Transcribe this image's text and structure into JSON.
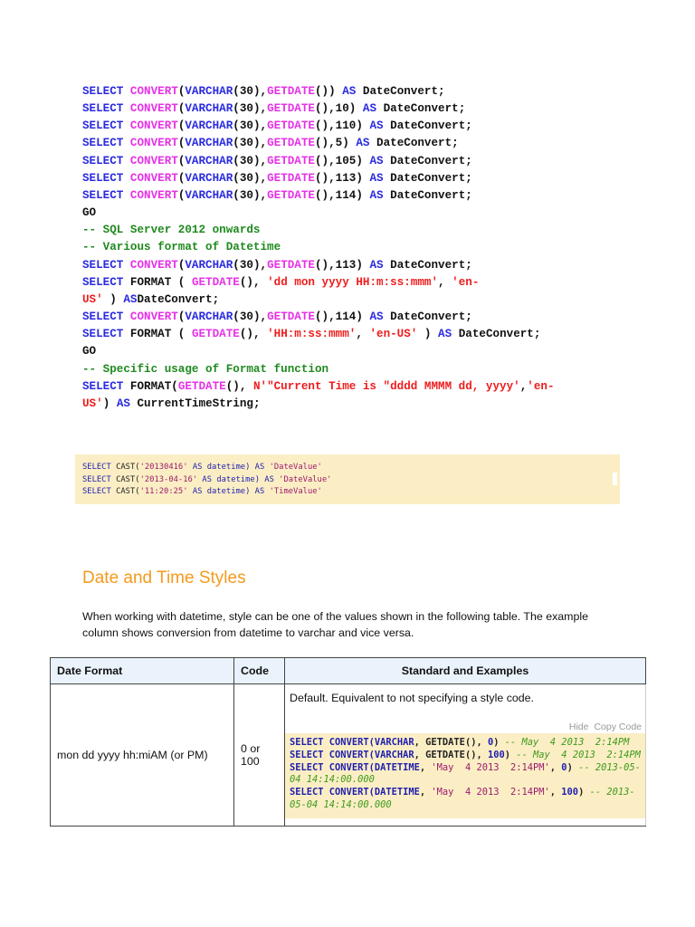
{
  "code_block_1": [
    [
      [
        "SELECT ",
        "k"
      ],
      [
        "CONVERT",
        "f"
      ],
      [
        "(",
        "d"
      ],
      [
        "VARCHAR",
        "k"
      ],
      [
        "(30),",
        "d"
      ],
      [
        "GETDATE",
        "f"
      ],
      [
        "()) ",
        "d"
      ],
      [
        "AS ",
        "k"
      ],
      [
        "DateConvert;",
        "d"
      ]
    ],
    [
      [
        "SELECT ",
        "k"
      ],
      [
        "CONVERT",
        "f"
      ],
      [
        "(",
        "d"
      ],
      [
        "VARCHAR",
        "k"
      ],
      [
        "(30),",
        "d"
      ],
      [
        "GETDATE",
        "f"
      ],
      [
        "(),10) ",
        "d"
      ],
      [
        "AS ",
        "k"
      ],
      [
        "DateConvert;",
        "d"
      ]
    ],
    [
      [
        "SELECT ",
        "k"
      ],
      [
        "CONVERT",
        "f"
      ],
      [
        "(",
        "d"
      ],
      [
        "VARCHAR",
        "k"
      ],
      [
        "(30),",
        "d"
      ],
      [
        "GETDATE",
        "f"
      ],
      [
        "(),110) ",
        "d"
      ],
      [
        "AS ",
        "k"
      ],
      [
        "DateConvert;",
        "d"
      ]
    ],
    [
      [
        "SELECT ",
        "k"
      ],
      [
        "CONVERT",
        "f"
      ],
      [
        "(",
        "d"
      ],
      [
        "VARCHAR",
        "k"
      ],
      [
        "(30),",
        "d"
      ],
      [
        "GETDATE",
        "f"
      ],
      [
        "(),5) ",
        "d"
      ],
      [
        "AS ",
        "k"
      ],
      [
        "DateConvert;",
        "d"
      ]
    ],
    [
      [
        "SELECT ",
        "k"
      ],
      [
        "CONVERT",
        "f"
      ],
      [
        "(",
        "d"
      ],
      [
        "VARCHAR",
        "k"
      ],
      [
        "(30),",
        "d"
      ],
      [
        "GETDATE",
        "f"
      ],
      [
        "(),105) ",
        "d"
      ],
      [
        "AS ",
        "k"
      ],
      [
        "DateConvert;",
        "d"
      ]
    ],
    [
      [
        "SELECT ",
        "k"
      ],
      [
        "CONVERT",
        "f"
      ],
      [
        "(",
        "d"
      ],
      [
        "VARCHAR",
        "k"
      ],
      [
        "(30),",
        "d"
      ],
      [
        "GETDATE",
        "f"
      ],
      [
        "(),113) ",
        "d"
      ],
      [
        "AS ",
        "k"
      ],
      [
        "DateConvert;",
        "d"
      ]
    ],
    [
      [
        "SELECT ",
        "k"
      ],
      [
        "CONVERT",
        "f"
      ],
      [
        "(",
        "d"
      ],
      [
        "VARCHAR",
        "k"
      ],
      [
        "(30),",
        "d"
      ],
      [
        "GETDATE",
        "f"
      ],
      [
        "(),114) ",
        "d"
      ],
      [
        "AS ",
        "k"
      ],
      [
        "DateConvert;",
        "d"
      ]
    ],
    [
      [
        "GO",
        "d"
      ]
    ],
    [
      [
        "-- SQL Server 2012 onwards",
        "c"
      ]
    ],
    [
      [
        "-- Various format of Datetime",
        "c"
      ]
    ],
    [
      [
        "SELECT ",
        "k"
      ],
      [
        "CONVERT",
        "f"
      ],
      [
        "(",
        "d"
      ],
      [
        "VARCHAR",
        "k"
      ],
      [
        "(30),",
        "d"
      ],
      [
        "GETDATE",
        "f"
      ],
      [
        "(),113) ",
        "d"
      ],
      [
        "AS ",
        "k"
      ],
      [
        "DateConvert;",
        "d"
      ]
    ],
    [
      [
        "SELECT ",
        "k"
      ],
      [
        "FORMAT ( ",
        "d"
      ],
      [
        "GETDATE",
        "f"
      ],
      [
        "(), ",
        "d"
      ],
      [
        "'dd mon yyyy HH:m:ss:mmm'",
        "s"
      ],
      [
        ", ",
        "d"
      ],
      [
        "'en-",
        "s"
      ]
    ],
    [
      [
        "US'",
        "s"
      ],
      [
        " ) ",
        "d"
      ],
      [
        "AS",
        "k"
      ],
      [
        "DateConvert;",
        "d"
      ]
    ],
    [
      [
        "SELECT ",
        "k"
      ],
      [
        "CONVERT",
        "f"
      ],
      [
        "(",
        "d"
      ],
      [
        "VARCHAR",
        "k"
      ],
      [
        "(30),",
        "d"
      ],
      [
        "GETDATE",
        "f"
      ],
      [
        "(),114) ",
        "d"
      ],
      [
        "AS ",
        "k"
      ],
      [
        "DateConvert;",
        "d"
      ]
    ],
    [
      [
        "SELECT ",
        "k"
      ],
      [
        "FORMAT ( ",
        "d"
      ],
      [
        "GETDATE",
        "f"
      ],
      [
        "(), ",
        "d"
      ],
      [
        "'HH:m:ss:mmm'",
        "s"
      ],
      [
        ", ",
        "d"
      ],
      [
        "'en-US'",
        "s"
      ],
      [
        " ) ",
        "d"
      ],
      [
        "AS ",
        "k"
      ],
      [
        "DateConvert;",
        "d"
      ]
    ],
    [
      [
        "GO",
        "d"
      ]
    ],
    [
      [
        "-- Specific usage of Format function",
        "c"
      ]
    ],
    [
      [
        "SELECT ",
        "k"
      ],
      [
        "FORMAT(",
        "d"
      ],
      [
        "GETDATE",
        "f"
      ],
      [
        "(), ",
        "d"
      ],
      [
        "N'\"Current Time is \"dddd MMMM dd, yyyy'",
        "s"
      ],
      [
        ",",
        "d"
      ],
      [
        "'en-",
        "s"
      ]
    ],
    [
      [
        "US'",
        "s"
      ],
      [
        ") ",
        "d"
      ],
      [
        "AS ",
        "k"
      ],
      [
        "CurrentTimeString;",
        "d"
      ]
    ]
  ],
  "code_block_2": [
    [
      [
        "SELECT ",
        "k"
      ],
      [
        "CAST(",
        "d"
      ],
      [
        "'20130416'",
        "s"
      ],
      [
        " AS ",
        "k"
      ],
      [
        "datetime",
        "k"
      ],
      [
        ") AS ",
        "k"
      ],
      [
        "'DateValue'",
        "s"
      ]
    ],
    [
      [
        "SELECT ",
        "k"
      ],
      [
        "CAST(",
        "d"
      ],
      [
        "'2013-04-16'",
        "s"
      ],
      [
        " AS ",
        "k"
      ],
      [
        "datetime",
        "k"
      ],
      [
        ") AS ",
        "k"
      ],
      [
        "'DateValue'",
        "s"
      ]
    ],
    [
      [
        "SELECT ",
        "k"
      ],
      [
        "CAST(",
        "d"
      ],
      [
        "'11:20:25'",
        "s"
      ],
      [
        " AS ",
        "k"
      ],
      [
        "datetime",
        "k"
      ],
      [
        ") AS ",
        "k"
      ],
      [
        "'TimeValue'",
        "s"
      ]
    ]
  ],
  "section": {
    "heading": "Date and Time Styles",
    "paragraph": "When working with datetime, style can be one of the values shown in the following table. The example column shows conversion from datetime to varchar and vice versa."
  },
  "table": {
    "headers": [
      "Date Format",
      "Code",
      "Standard and Examples"
    ],
    "rows": [
      {
        "format": "mon dd yyyy hh:miAM (or PM)",
        "code": "0 or 100",
        "description": "Default. Equivalent to not specifying a style code.",
        "hide_label": "Hide",
        "copy_label": "Copy Code"
      }
    ]
  },
  "code_block_3": [
    [
      [
        "SELECT ",
        "k"
      ],
      [
        "CONVERT(",
        "k"
      ],
      [
        "VARCHAR",
        "k"
      ],
      [
        ", GETDATE(), ",
        "d"
      ],
      [
        "0",
        "k"
      ],
      [
        ") ",
        "d"
      ],
      [
        "-- May  4 2013  2:14PM",
        "c"
      ]
    ],
    [
      [
        "SELECT ",
        "k"
      ],
      [
        "CONVERT(",
        "k"
      ],
      [
        "VARCHAR",
        "k"
      ],
      [
        ", GETDATE(), ",
        "d"
      ],
      [
        "100",
        "k"
      ],
      [
        ") ",
        "d"
      ],
      [
        "-- May  4 2013  2:14PM",
        "c"
      ]
    ],
    [
      [
        "SELECT ",
        "k"
      ],
      [
        "CONVERT(",
        "k"
      ],
      [
        "DATETIME",
        "k"
      ],
      [
        ", ",
        "d"
      ],
      [
        "'May  4 2013  2:14PM'",
        "s"
      ],
      [
        ", ",
        "d"
      ],
      [
        "0",
        "k"
      ],
      [
        ") ",
        "d"
      ],
      [
        "-- 2013-05-",
        "c"
      ]
    ],
    [
      [
        "04 14:14:00.000",
        "c"
      ]
    ],
    [
      [
        "SELECT ",
        "k"
      ],
      [
        "CONVERT(",
        "k"
      ],
      [
        "DATETIME",
        "k"
      ],
      [
        ", ",
        "d"
      ],
      [
        "'May  4 2013  2:14PM'",
        "s"
      ],
      [
        ", ",
        "d"
      ],
      [
        "100",
        "k"
      ],
      [
        ") ",
        "d"
      ],
      [
        "-- 2013-",
        "c"
      ]
    ],
    [
      [
        "05-04 14:14:00.000",
        "c"
      ]
    ]
  ]
}
